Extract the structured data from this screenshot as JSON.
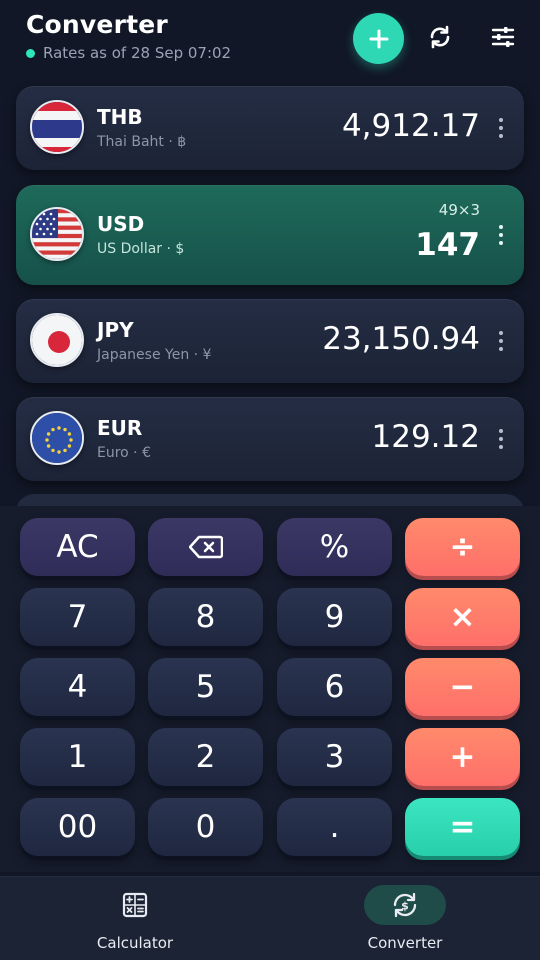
{
  "header": {
    "title": "Converter",
    "rates_status": "Rates as of 28 Sep 07:02",
    "icons": {
      "add": "plus-icon",
      "refresh": "refresh-icon",
      "settings": "sliders-icon"
    }
  },
  "currencies": [
    {
      "code": "THB",
      "name": "Thai Baht · ฿",
      "amount": "4,912.17",
      "flag": "flag-thailand"
    },
    {
      "code": "USD",
      "name": "US Dollar · $",
      "amount": "147",
      "expression": "49×3",
      "flag": "flag-usa",
      "active": true
    },
    {
      "code": "JPY",
      "name": "Japanese Yen · ¥",
      "amount": "23,150.94",
      "flag": "flag-japan"
    },
    {
      "code": "EUR",
      "name": "Euro · €",
      "amount": "129.12",
      "flag": "flag-eu"
    }
  ],
  "keypad": {
    "ac": "AC",
    "backspace": "backspace-icon",
    "percent": "%",
    "divide": "÷",
    "multiply": "×",
    "minus": "−",
    "plus": "+",
    "equals": "=",
    "d7": "7",
    "d8": "8",
    "d9": "9",
    "d4": "4",
    "d5": "5",
    "d6": "6",
    "d1": "1",
    "d2": "2",
    "d3": "3",
    "d00": "00",
    "d0": "0",
    "dot": "."
  },
  "bottom_nav": {
    "items": [
      {
        "label": "Calculator",
        "icon": "calculator-icon"
      },
      {
        "label": "Converter",
        "icon": "currency-exchange-icon",
        "active": true
      }
    ]
  },
  "colors": {
    "background": "#111726",
    "accent": "#2ed8b4",
    "active_card": "#1e6a5a",
    "operator": "#ff7a6b"
  }
}
